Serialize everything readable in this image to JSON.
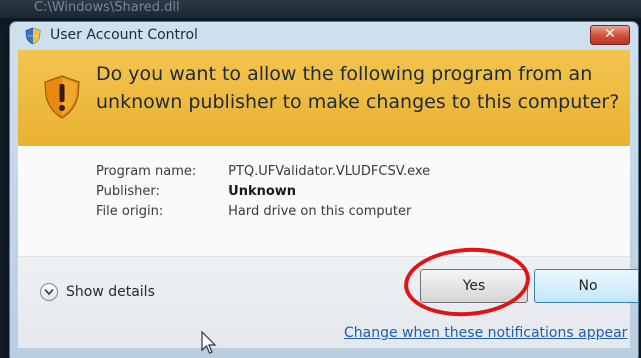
{
  "background": {
    "partial_text": "C:\\Windows\\Shared.dll"
  },
  "dialog": {
    "title": "User Account Control",
    "close_glyph": "✕",
    "question": "Do you want to allow the following program from an unknown publisher to make changes to this computer?",
    "fields": [
      {
        "label": "Program name:",
        "value": "PTQ.UFValidator.VLUDFCSV.exe"
      },
      {
        "label": "Publisher:",
        "value": "Unknown"
      },
      {
        "label": "File origin:",
        "value": "Hard drive on this computer"
      }
    ],
    "show_details_label": "Show details",
    "yes_label": "Yes",
    "no_label": "No",
    "change_link_label": "Change when these notifications appear"
  },
  "icons": {
    "title": "uac-shield-icon",
    "banner": "warning-shield-icon",
    "details": "chevron-down-icon",
    "cursor": "mouse-pointer-icon"
  },
  "colors": {
    "banner": "#e9b232",
    "close_button": "#d4523c",
    "link": "#1f5fa8",
    "highlight_circle": "#e01414"
  }
}
